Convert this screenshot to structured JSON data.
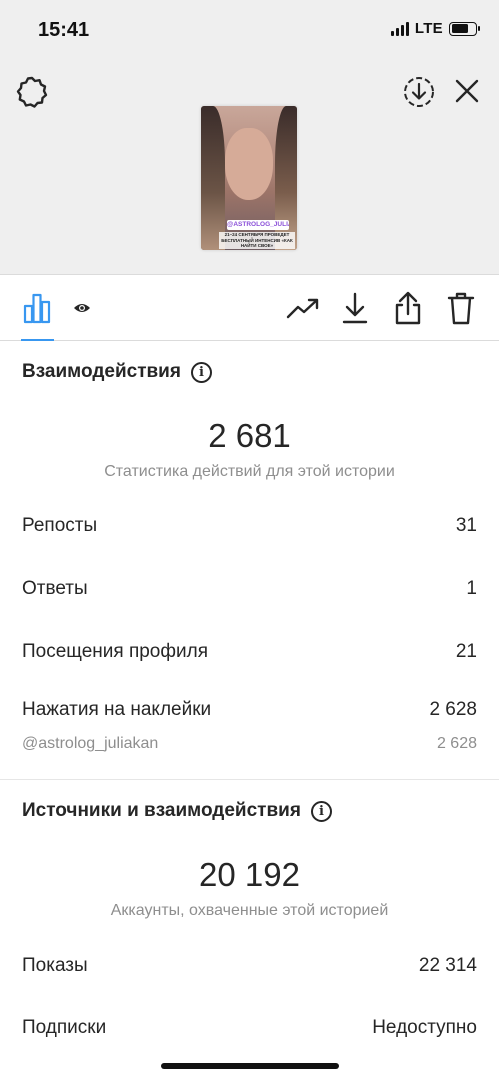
{
  "status_bar": {
    "time": "15:41",
    "network": "LTE"
  },
  "story": {
    "mention": "@ASTROLOG_JULIAKAN",
    "caption": "21–24 СЕНТЯБРЯ ПРОВЕДЕТ БЕСПЛАТНЫЙ ИНТЕНСИВ «КАК НАЙТИ СВОЕ»"
  },
  "toolbar": {
    "settings_icon": "gear-icon",
    "download_icon": "download-circle-icon",
    "close_icon": "close-icon"
  },
  "tabs": {
    "active": "stats-icon",
    "views": "eye-icon",
    "promote": "trending-icon",
    "save": "download-icon",
    "share": "share-icon",
    "delete": "trash-icon"
  },
  "interactions": {
    "title": "Взаимодействия",
    "total": "2 681",
    "subtitle": "Статистика действий для этой истории",
    "rows": [
      {
        "label": "Репосты",
        "value": "31"
      },
      {
        "label": "Ответы",
        "value": "1"
      },
      {
        "label": "Посещения профиля",
        "value": "21"
      },
      {
        "label": "Нажатия на наклейки",
        "value": "2 628"
      }
    ],
    "sticker": {
      "label": "@astrolog_juliakan",
      "value": "2 628"
    }
  },
  "discovery": {
    "title": "Источники и взаимодействия",
    "total": "20 192",
    "subtitle": "Аккаунты, охваченные этой историей",
    "rows": [
      {
        "label": "Показы",
        "value": "22 314"
      },
      {
        "label": "Подписки",
        "value": "Недоступно"
      }
    ]
  },
  "colors": {
    "accent": "#3897f0",
    "text": "#262626",
    "secondary": "#8e8e8e"
  }
}
